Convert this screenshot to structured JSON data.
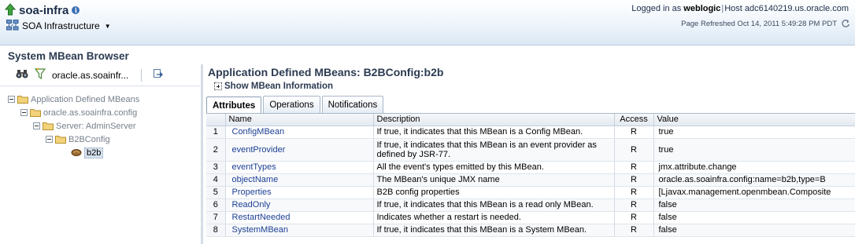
{
  "header": {
    "app_title": "soa-infra",
    "target_menu": "SOA Infrastructure",
    "logged_in_prefix": "Logged in as",
    "user": "weblogic",
    "host_label": "Host",
    "host": "adc6140219.us.oracle.com",
    "refreshed_text": "Page Refreshed Oct 14, 2011 5:49:28 PM PDT"
  },
  "browser": {
    "title": "System MBean Browser",
    "toolbar_path": "oracle.as.soainfr..."
  },
  "tree": [
    {
      "label": "Application Defined MBeans"
    },
    {
      "label": "oracle.as.soainfra.config"
    },
    {
      "label": "Server: AdminServer"
    },
    {
      "label": "B2BConfig"
    },
    {
      "label": "b2b"
    }
  ],
  "mbean": {
    "title": "Application Defined MBeans: B2BConfig:b2b",
    "show_info": "Show MBean Information"
  },
  "tabs": [
    "Attributes",
    "Operations",
    "Notifications"
  ],
  "table": {
    "columns": [
      "",
      "Name",
      "Description",
      "Access",
      "Value"
    ],
    "rows": [
      {
        "num": "1",
        "name": "ConfigMBean",
        "desc": "If true, it indicates that this MBean is a Config MBean.",
        "access": "R",
        "value": "true"
      },
      {
        "num": "2",
        "name": "eventProvider",
        "desc": "If true, it indicates that this MBean is an event provider as defined by JSR-77.",
        "access": "R",
        "value": "true"
      },
      {
        "num": "3",
        "name": "eventTypes",
        "desc": "All the event's types emitted by this MBean.",
        "access": "R",
        "value": "jmx.attribute.change"
      },
      {
        "num": "4",
        "name": "objectName",
        "desc": "The MBean's unique JMX name",
        "access": "R",
        "value": "oracle.as.soainfra.config:name=b2b,type=B"
      },
      {
        "num": "5",
        "name": "Properties",
        "desc": "B2B config properties",
        "access": "R",
        "value": "[Ljavax.management.openmbean.Composite"
      },
      {
        "num": "6",
        "name": "ReadOnly",
        "desc": "If true, it indicates that this MBean is a read only MBean.",
        "access": "R",
        "value": "false"
      },
      {
        "num": "7",
        "name": "RestartNeeded",
        "desc": "Indicates whether a restart is needed.",
        "access": "R",
        "value": "false"
      },
      {
        "num": "8",
        "name": "SystemMBean",
        "desc": "If true, it indicates that this MBean is a System MBean.",
        "access": "R",
        "value": "false"
      }
    ]
  },
  "colors": {
    "link": "#1c3f94",
    "title": "#2c3b52",
    "header_bg": "#dbe7f4"
  },
  "icons": [
    "up-arrow-icon",
    "info-icon",
    "soa-infrastructure-icon",
    "refresh-icon",
    "binoculars-icon",
    "filter-icon",
    "export-icon",
    "folder-icon",
    "mbean-bean-icon",
    "expand-plus-icon"
  ]
}
